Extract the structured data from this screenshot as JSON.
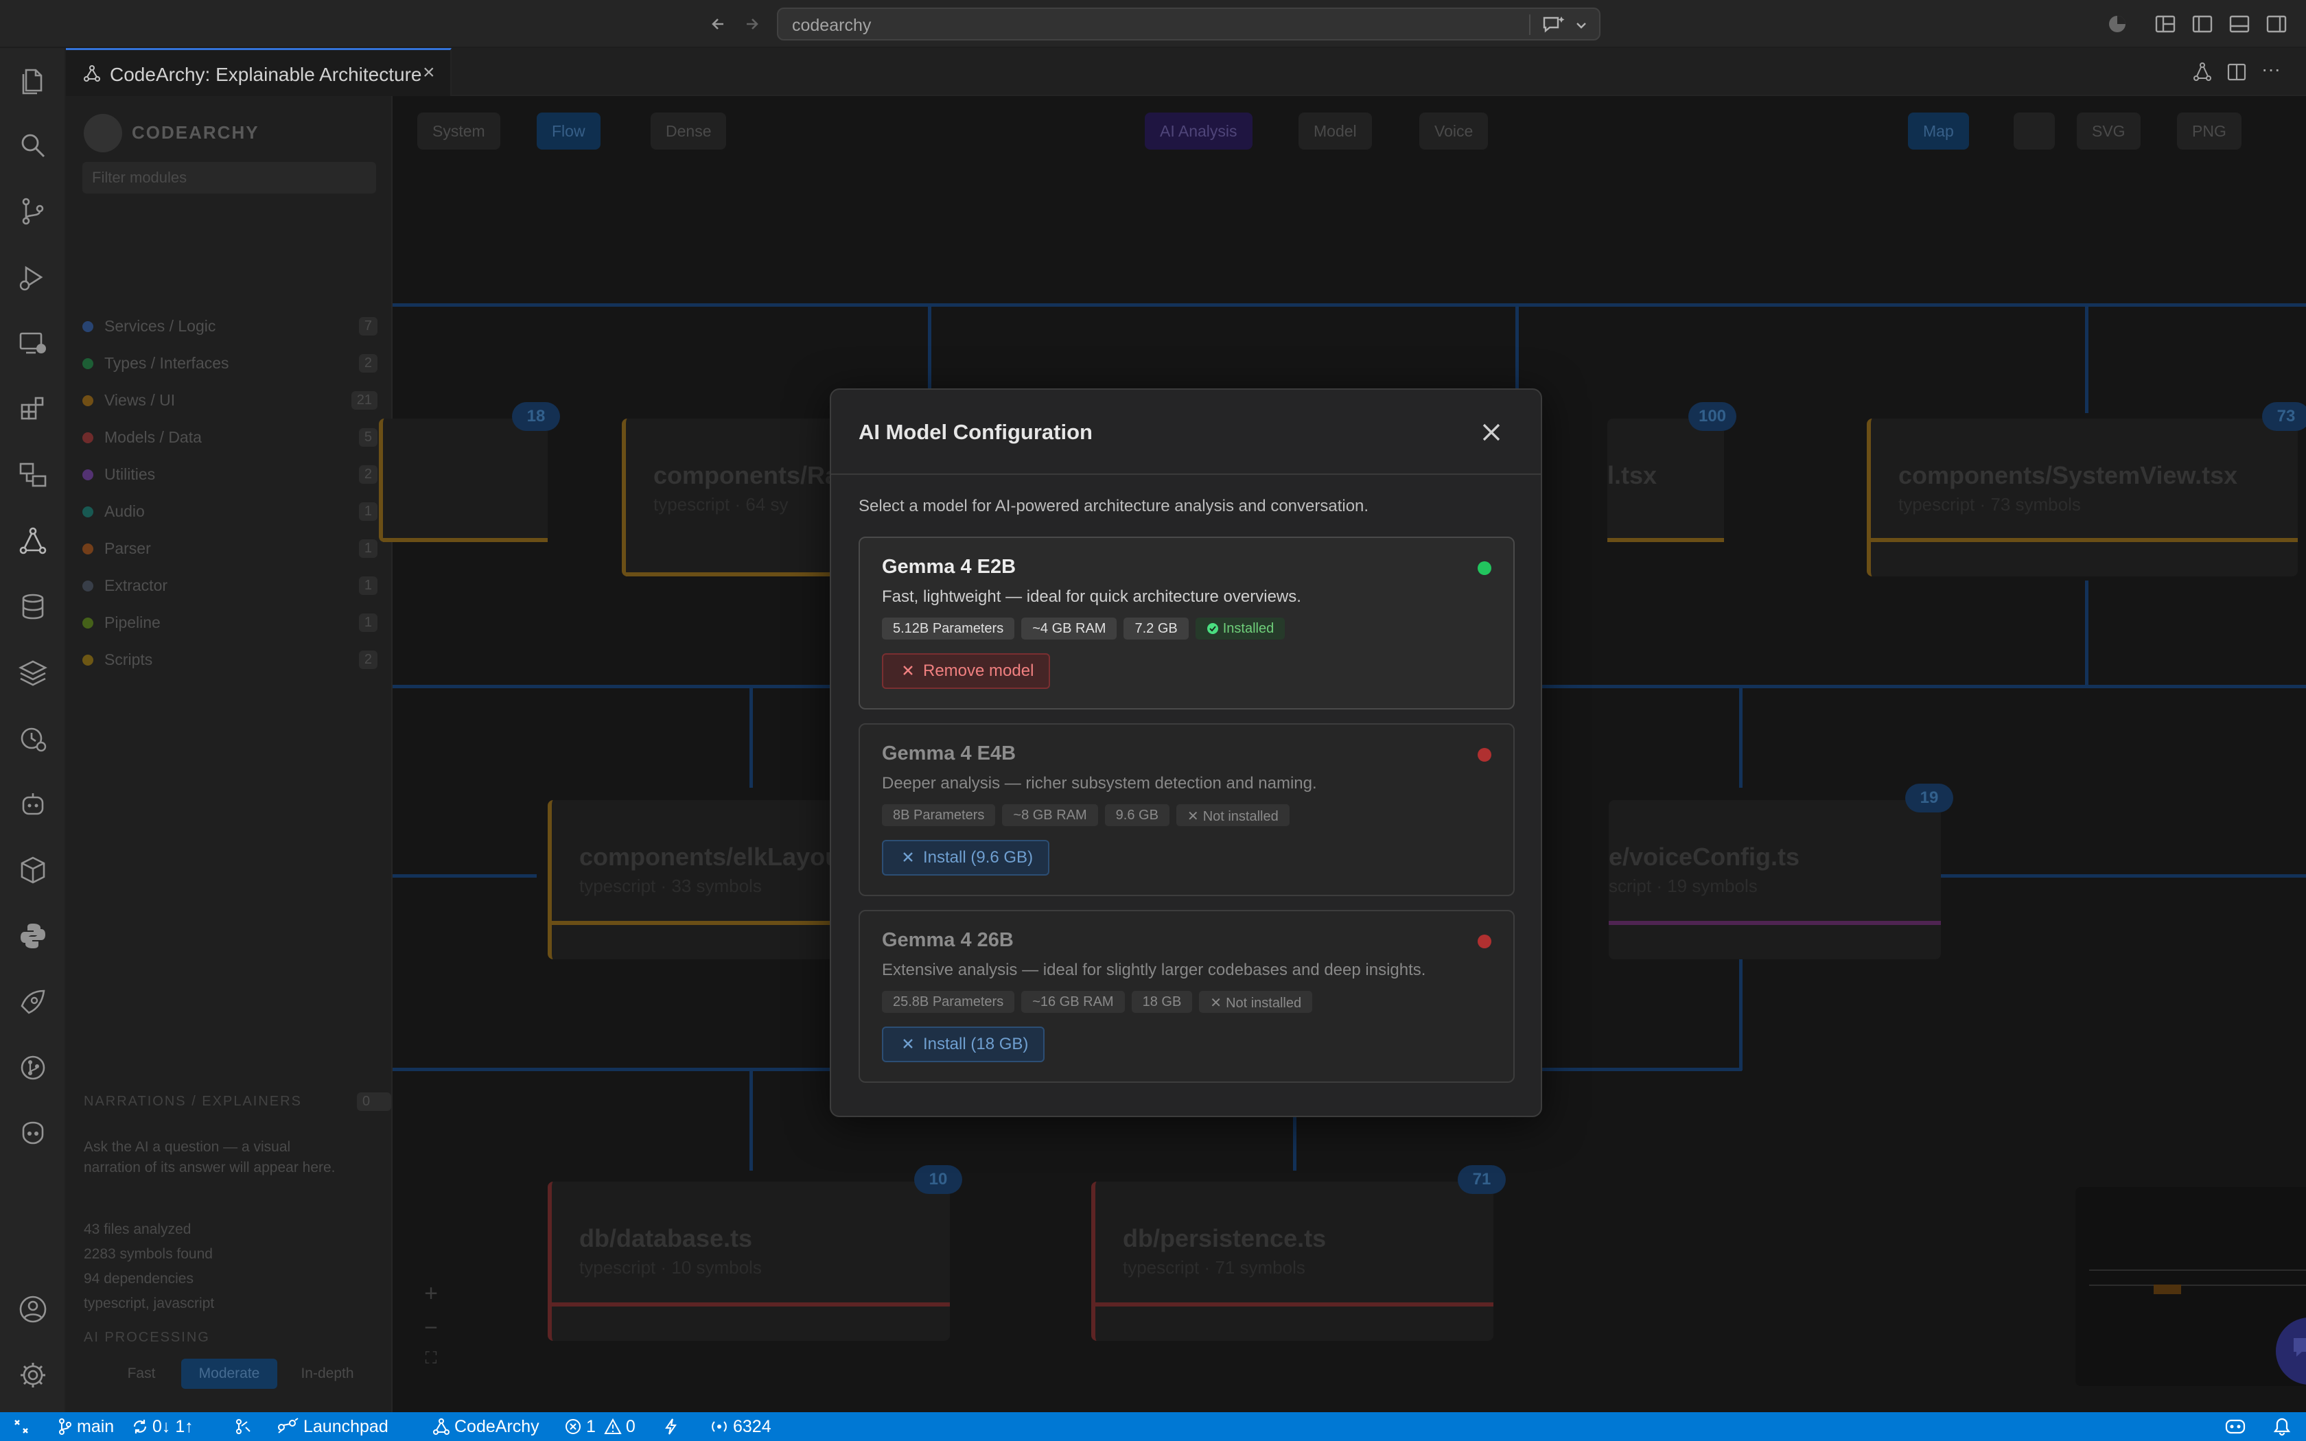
{
  "titlebar": {
    "search": "codearchy"
  },
  "tab": {
    "title": "CodeArchy: Explainable Architecture"
  },
  "sidebar": {
    "brand": "CODEARCHY",
    "filter_placeholder": "Filter modules",
    "legend": [
      {
        "label": "Services / Logic",
        "count": "7",
        "color": "#3b82f6"
      },
      {
        "label": "Types / Interfaces",
        "count": "2",
        "color": "#22c55e"
      },
      {
        "label": "Views / UI",
        "count": "21",
        "color": "#f59e0b"
      },
      {
        "label": "Models / Data",
        "count": "5",
        "color": "#ef4444"
      },
      {
        "label": "Utilities",
        "count": "2",
        "color": "#a855f7"
      },
      {
        "label": "Audio",
        "count": "1",
        "color": "#14b8a6"
      },
      {
        "label": "Parser",
        "count": "1",
        "color": "#f97316"
      },
      {
        "label": "Extractor",
        "count": "1",
        "color": "#64748b"
      },
      {
        "label": "Pipeline",
        "count": "1",
        "color": "#84cc16"
      },
      {
        "label": "Scripts",
        "count": "2",
        "color": "#eab308"
      }
    ],
    "narrations_heading": "NARRATIONS / EXPLAINERS",
    "narrations_count": "0",
    "narrations_text_1": "Ask the AI a question — a visual",
    "narrations_text_2": "narration of its answer will appear here.",
    "stats": [
      "43 files analyzed",
      "2283 symbols found",
      "94 dependencies",
      "typescript, javascript"
    ],
    "processing_heading": "AI PROCESSING",
    "processing_options": [
      "Fast",
      "Moderate",
      "In-depth"
    ]
  },
  "toolbar": {
    "system": "System",
    "flow": "Flow",
    "dense": "Dense",
    "ai_analysis": "AI Analysis",
    "model": "Model",
    "voice": "Voice",
    "map": "Map",
    "svg": "SVG",
    "png": "PNG"
  },
  "nodes": [
    {
      "title": "components/Ra",
      "sub": "typescript · 64 sy",
      "badge": ""
    },
    {
      "title": "l.tsx",
      "sub": "",
      "badge": "100"
    },
    {
      "title": "components/SystemView.tsx",
      "sub": "typescript · 73 symbols",
      "badge": "73"
    },
    {
      "title": "components/elkLayout.ts",
      "sub": "typescript · 33 symbols",
      "badge": ""
    },
    {
      "title": "e/voiceConfig.ts",
      "sub": "script · 19 symbols",
      "badge": "19"
    },
    {
      "title": "db/database.ts",
      "sub": "typescript · 10 symbols",
      "badge": "10"
    },
    {
      "title": "db/persistence.ts",
      "sub": "typescript · 71 symbols",
      "badge": "71"
    },
    {
      "title": "",
      "sub": "",
      "badge": "18"
    }
  ],
  "modal": {
    "title": "AI Model Configuration",
    "description": "Select a model for AI-powered architecture analysis and conversation.",
    "models": [
      {
        "name": "Gemma 4 E2B",
        "description": "Fast, lightweight — ideal for quick architecture overviews.",
        "params": "5.12B Parameters",
        "ram": "~4 GB RAM",
        "size": "7.2 GB",
        "status": "Installed",
        "action": "Remove model",
        "status_color": "#22c55e"
      },
      {
        "name": "Gemma 4 E4B",
        "description": "Deeper analysis — richer subsystem detection and naming.",
        "params": "8B Parameters",
        "ram": "~8 GB RAM",
        "size": "9.6 GB",
        "status": "Not installed",
        "action": "Install (9.6 GB)",
        "status_color": "#b03030"
      },
      {
        "name": "Gemma 4 26B",
        "description": "Extensive analysis — ideal for slightly larger codebases and deep insights.",
        "params": "25.8B Parameters",
        "ram": "~16 GB RAM",
        "size": "18 GB",
        "status": "Not installed",
        "action": "Install (18 GB)",
        "status_color": "#b03030"
      }
    ]
  },
  "statusbar": {
    "branch": "main",
    "sync": "0↓ 1↑",
    "launchpad": "Launchpad",
    "codearchy": "CodeArchy",
    "errors": "1",
    "warnings": "0",
    "port": "6324"
  }
}
